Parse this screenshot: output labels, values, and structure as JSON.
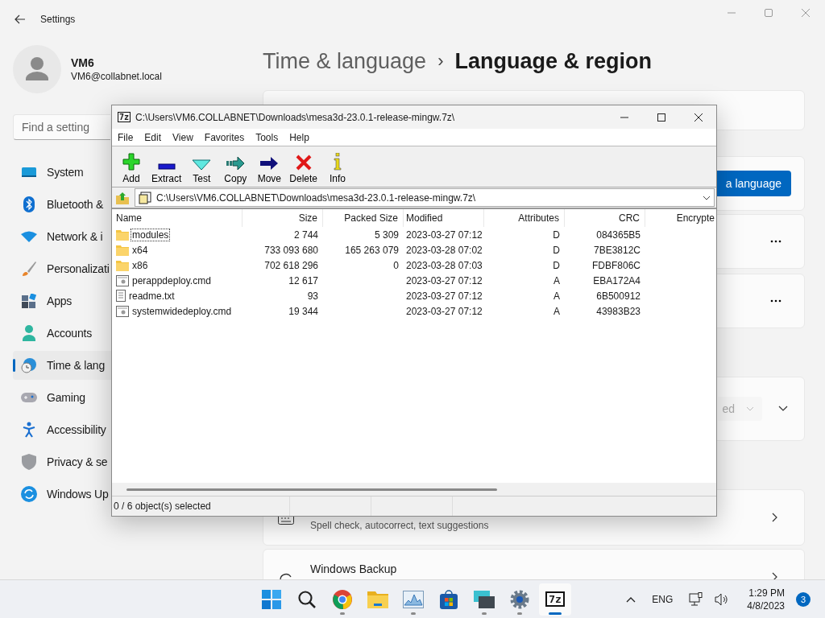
{
  "settings": {
    "title": "Settings",
    "user": {
      "name": "VM6",
      "email": "VM6@collabnet.local"
    },
    "search": {
      "placeholder": "Find a setting"
    },
    "nav": [
      {
        "label": "System",
        "selected": false
      },
      {
        "label": "Bluetooth &",
        "selected": false
      },
      {
        "label": "Network & i",
        "selected": false
      },
      {
        "label": "Personalizati",
        "selected": false
      },
      {
        "label": "Apps",
        "selected": false
      },
      {
        "label": "Accounts",
        "selected": false
      },
      {
        "label": "Time & lang",
        "selected": true
      },
      {
        "label": "Gaming",
        "selected": false
      },
      {
        "label": "Accessibility",
        "selected": false
      },
      {
        "label": "Privacy & se",
        "selected": false
      },
      {
        "label": "Windows Up",
        "selected": false
      }
    ],
    "breadcrumb": {
      "parent": "Time & language",
      "separator": "›",
      "current": "Language & region"
    },
    "add_language_button": "a language",
    "dropdown_value": "ed",
    "typing_subtitle": "Spell check, autocorrect, text suggestions",
    "backup_title": "Windows Backup"
  },
  "archive_window": {
    "icon_text": "7z",
    "title": "C:\\Users\\VM6.COLLABNET\\Downloads\\mesa3d-23.0.1-release-mingw.7z\\",
    "menu": [
      "File",
      "Edit",
      "View",
      "Favorites",
      "Tools",
      "Help"
    ],
    "toolbar": [
      "Add",
      "Extract",
      "Test",
      "Copy",
      "Move",
      "Delete",
      "Info"
    ],
    "address": "C:\\Users\\VM6.COLLABNET\\Downloads\\mesa3d-23.0.1-release-mingw.7z\\",
    "columns": [
      "Name",
      "Size",
      "Packed Size",
      "Modified",
      "Attributes",
      "CRC",
      "Encrypte"
    ],
    "rows": [
      {
        "kind": "folder",
        "focused": true,
        "name": "modules",
        "size": "2 744",
        "packed_size": "5 309",
        "modified": "2023-03-27 07:12",
        "attributes": "D",
        "crc": "084365B5"
      },
      {
        "kind": "folder",
        "focused": false,
        "name": "x64",
        "size": "733 093 680",
        "packed_size": "165 263 079",
        "modified": "2023-03-28 07:02",
        "attributes": "D",
        "crc": "7BE3812C"
      },
      {
        "kind": "folder",
        "focused": false,
        "name": "x86",
        "size": "702 618 296",
        "packed_size": "0",
        "modified": "2023-03-28 07:03",
        "attributes": "D",
        "crc": "FDBF806C"
      },
      {
        "kind": "script",
        "focused": false,
        "name": "perappdeploy.cmd",
        "size": "12 617",
        "modified": "2023-03-27 07:12",
        "attributes": "A",
        "crc": "EBA172A4"
      },
      {
        "kind": "text",
        "focused": false,
        "name": "readme.txt",
        "size": "93",
        "modified": "2023-03-27 07:12",
        "attributes": "A",
        "crc": "6B500912"
      },
      {
        "kind": "script",
        "focused": false,
        "name": "systemwidedeploy.cmd",
        "size": "19 344",
        "modified": "2023-03-27 07:12",
        "attributes": "A",
        "crc": "43983B23"
      }
    ],
    "status": "0 / 6 object(s) selected"
  },
  "taskbar": {
    "apps": [
      {
        "running": true,
        "selected": false
      },
      {
        "running": false,
        "selected": false
      },
      {
        "running": true,
        "selected": false
      },
      {
        "running": false,
        "selected": false
      },
      {
        "running": true,
        "selected": false
      },
      {
        "running": true,
        "selected": false
      },
      {
        "running": true,
        "selected": true,
        "icon_text": "7z"
      }
    ],
    "tray": {
      "language": "ENG",
      "time": "1:29 PM",
      "date": "4/8/2023",
      "notifications": "3"
    }
  }
}
